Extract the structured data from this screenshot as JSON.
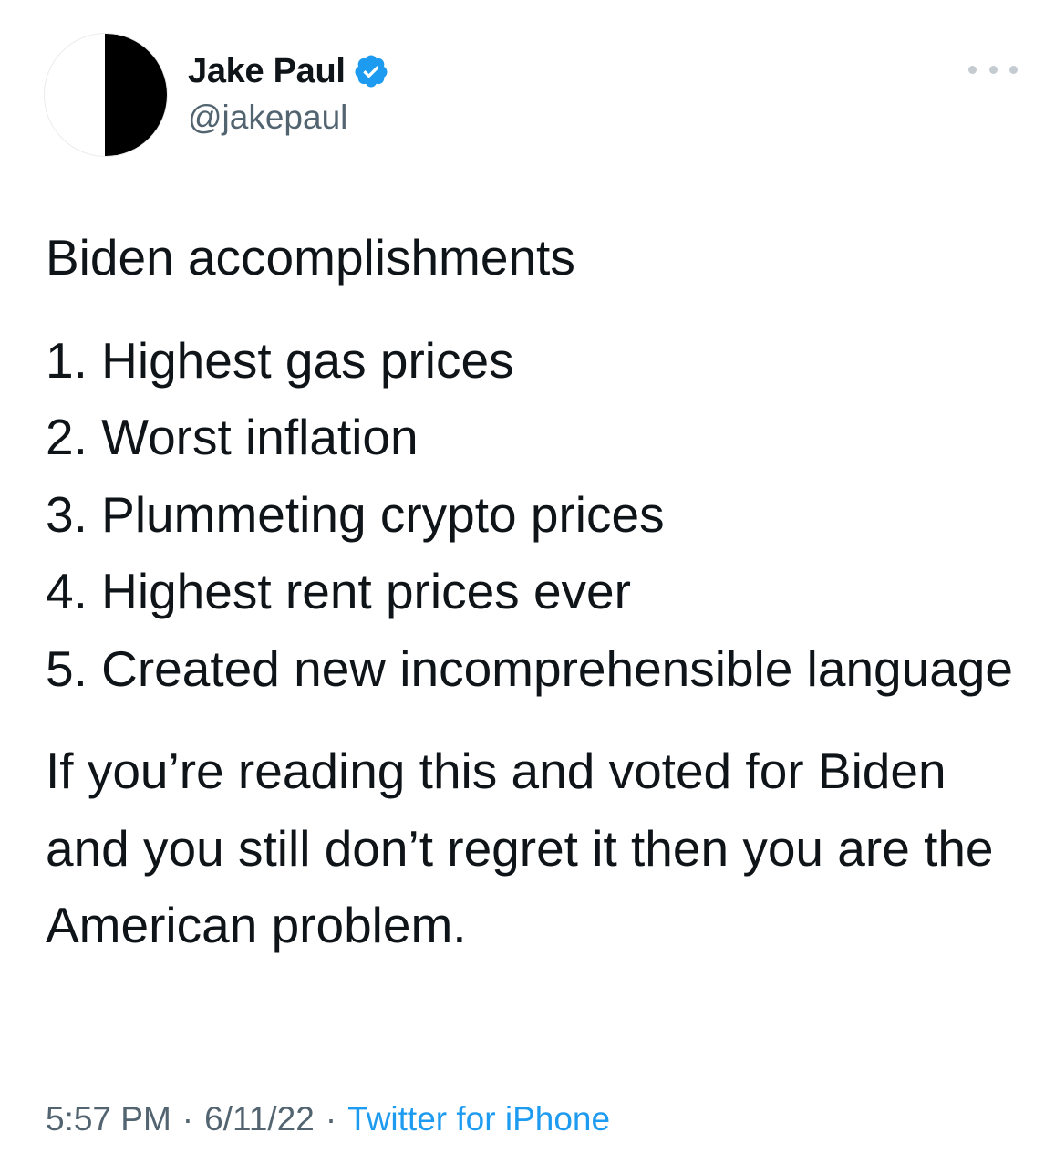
{
  "author": {
    "display_name": "Jake Paul",
    "handle": "@jakepaul",
    "verified": true,
    "avatar_icon": "half-black-circle-avatar"
  },
  "tweet": {
    "intro": "Biden accomplishments",
    "list": [
      "1. Highest gas prices",
      "2. Worst inflation",
      "3. Plummeting crypto prices",
      "4. Highest rent prices ever",
      "5. Created new incomprehensible language"
    ],
    "closing": "If you’re reading this and voted for Biden and you still don’t regret it then you are the American problem."
  },
  "meta": {
    "time": "5:57 PM",
    "separator": "·",
    "date": "6/11/22",
    "source": "Twitter for iPhone"
  },
  "icons": {
    "more": "more-options-icon",
    "verified": "verified-badge-icon"
  },
  "colors": {
    "text_primary": "#0f1419",
    "text_secondary": "#536471",
    "link": "#1d9bf0",
    "verified_badge": "#1d9bf0"
  }
}
